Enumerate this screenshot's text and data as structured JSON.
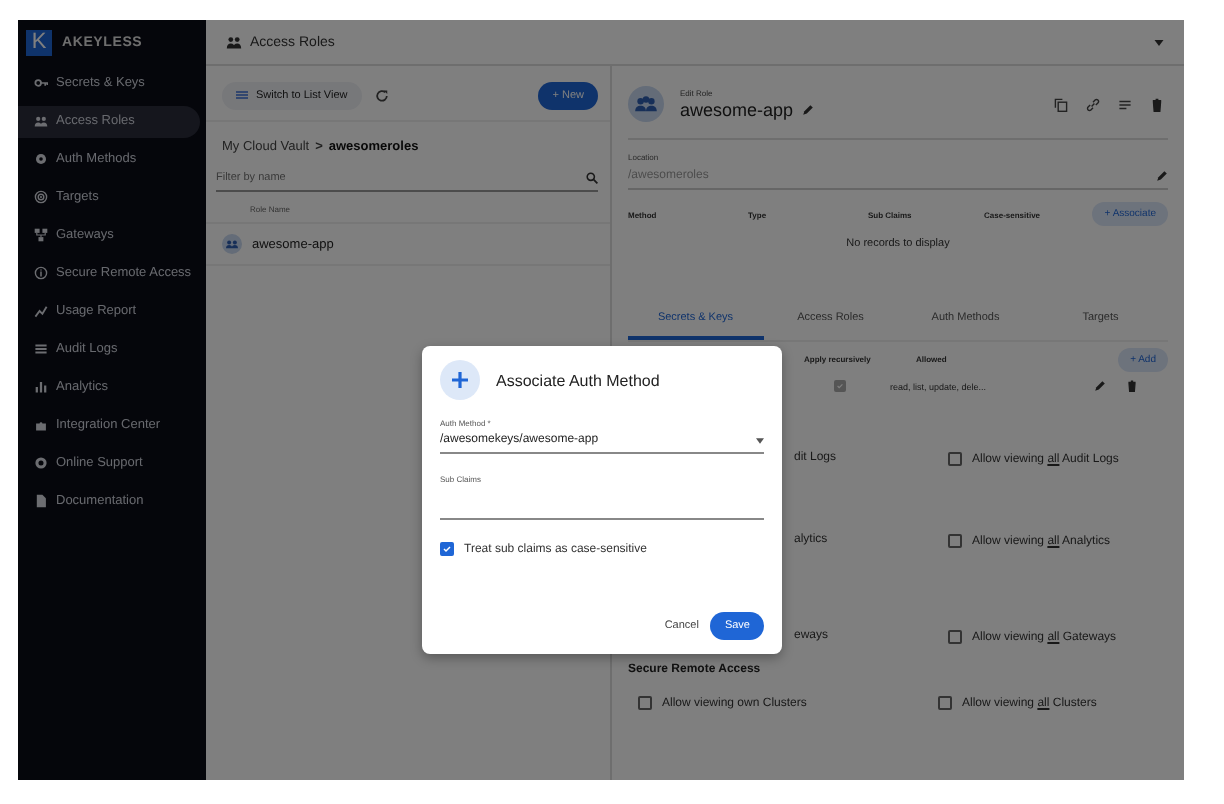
{
  "sidebar": {
    "logo_letter": "K",
    "brand": "AKEYLESS",
    "items": [
      {
        "label": "Secrets & Keys",
        "selected": false
      },
      {
        "label": "Access Roles",
        "selected": true
      },
      {
        "label": "Auth Methods",
        "selected": false
      },
      {
        "label": "Targets",
        "selected": false
      },
      {
        "label": "Gateways",
        "selected": false
      },
      {
        "label": "Secure Remote Access",
        "selected": false
      },
      {
        "label": "Usage Report",
        "selected": false
      },
      {
        "label": "Audit Logs",
        "selected": false
      },
      {
        "label": "Analytics",
        "selected": false
      },
      {
        "label": "Integration Center",
        "selected": false
      },
      {
        "label": "Online Support",
        "selected": false
      },
      {
        "label": "Documentation",
        "selected": false
      }
    ]
  },
  "header": {
    "title": "Access Roles"
  },
  "roles_panel": {
    "switch_button": "Switch to List View",
    "new_button": "+ New",
    "breadcrumb": {
      "root": "My Cloud Vault",
      "separator": ">",
      "current": "awesomeroles"
    },
    "filter": {
      "placeholder": "Filter by name"
    },
    "column": "Role Name",
    "rows": [
      {
        "name": "awesome-app",
        "selected": false
      }
    ]
  },
  "role_editor": {
    "caption": "Edit Role",
    "name": "awesome-app",
    "location_label": "Location",
    "location": "/awesomeroles",
    "auth_table": {
      "columns": [
        "Method",
        "Type",
        "Sub Claims",
        "Case-sensitive"
      ],
      "associate_button": "+ Associate",
      "empty": "No records to display"
    },
    "tabs": [
      {
        "label": "Secrets & Keys",
        "selected": true
      },
      {
        "label": "Access Roles",
        "selected": false
      },
      {
        "label": "Auth Methods",
        "selected": false
      },
      {
        "label": "Targets",
        "selected": false
      }
    ],
    "rules_table": {
      "columns": [
        "Apply recursively",
        "Allowed"
      ],
      "add_button": "+ Add",
      "rows": [
        {
          "apply_recursively": true,
          "allowed": "read, list, update, dele..."
        }
      ]
    },
    "permissions": [
      {
        "kind": "row",
        "left": {
          "kind": "fragment",
          "text": "dit Logs"
        },
        "right": {
          "before": "Allow viewing",
          "emphasis": "all",
          "after": "Audit Logs",
          "checked": false
        }
      },
      {
        "kind": "row",
        "left": {
          "kind": "fragment",
          "text": "alytics"
        },
        "right": {
          "before": "Allow viewing",
          "emphasis": "all",
          "after": "Analytics",
          "checked": false
        }
      },
      {
        "kind": "row",
        "left": {
          "kind": "fragment",
          "text": "eways"
        },
        "right": {
          "before": "Allow viewing",
          "emphasis": "all",
          "after": "Gateways",
          "checked": false
        }
      },
      {
        "kind": "heading",
        "title": "Secure Remote Access"
      },
      {
        "kind": "row",
        "left": {
          "kind": "checkbox",
          "text": "Allow viewing own Clusters",
          "checked": false
        },
        "right": {
          "before": "Allow viewing",
          "emphasis": "all",
          "after": "Clusters",
          "checked": false
        }
      }
    ]
  },
  "dialog": {
    "title": "Associate Auth Method",
    "auth_method_label": "Auth Method *",
    "auth_method": "/awesomekeys/awesome-app",
    "sub_claims_label": "Sub Claims",
    "case_sensitive": {
      "label": "Treat sub claims as case-sensitive",
      "checked": true
    },
    "buttons": {
      "cancel": "Cancel",
      "save": "Save"
    }
  }
}
